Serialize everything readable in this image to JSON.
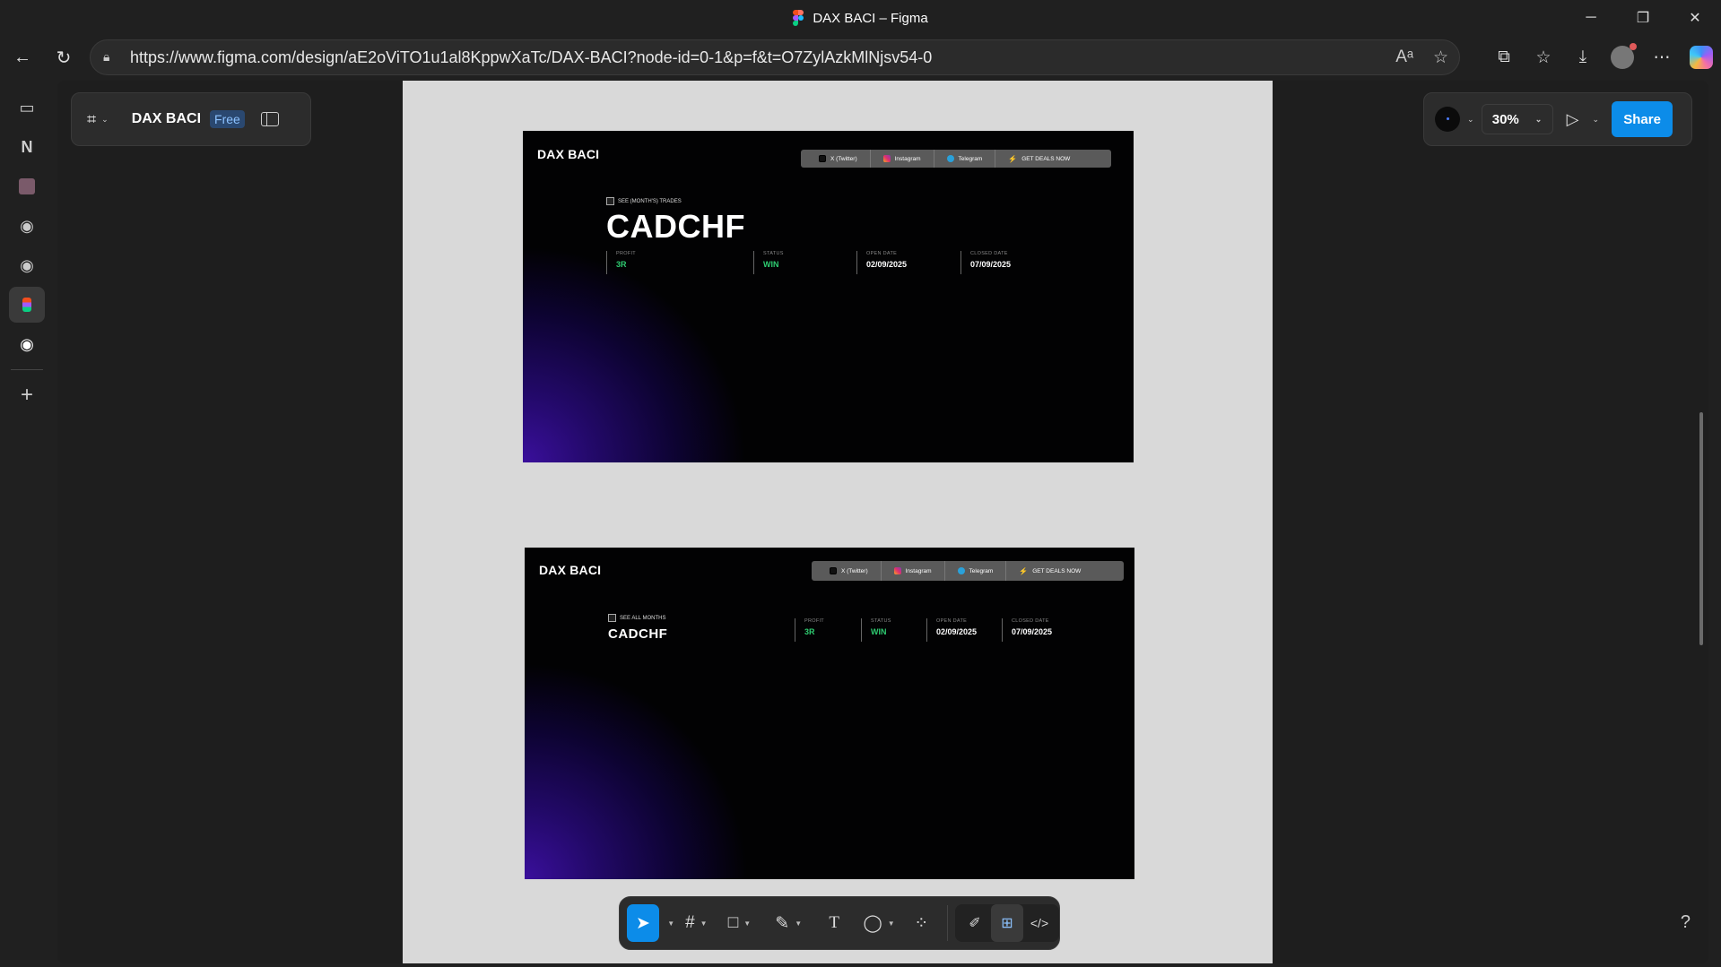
{
  "window": {
    "title": "DAX BACI – Figma"
  },
  "browser": {
    "url": "https://www.figma.com/design/aE2oViTO1u1al8KppwXaTc/DAX-BACI?node-id=0-1&p=f&t=O7ZylAzkMlNjsv54-0"
  },
  "file": {
    "name": "DAX BACI",
    "plan_badge": "Free"
  },
  "header": {
    "zoom": "30%",
    "share_label": "Share"
  },
  "frame1": {
    "brand": "DAX BACI",
    "nav": [
      "X (Twitter)",
      "Instagram",
      "Telegram",
      "GET DEALS NOW"
    ],
    "see_link": "SEE (MONTH'S) TRADES",
    "pair": "CADCHF",
    "stats": [
      {
        "label": "PROFIT",
        "value": "3R"
      },
      {
        "label": "STATUS",
        "value": "WIN"
      },
      {
        "label": "OPEN DATE",
        "value": "02/09/2025"
      },
      {
        "label": "CLOSED DATE",
        "value": "07/09/2025"
      }
    ]
  },
  "frame2": {
    "brand": "DAX BACI",
    "nav": [
      "X (Twitter)",
      "Instagram",
      "Telegram",
      "GET DEALS NOW"
    ],
    "see_link": "SEE ALL MONTHS",
    "pair": "CADCHF",
    "stats": [
      {
        "label": "PROFIT",
        "value": "3R"
      },
      {
        "label": "STATUS",
        "value": "WIN"
      },
      {
        "label": "OPEN DATE",
        "value": "02/09/2025"
      },
      {
        "label": "CLOSED DATE",
        "value": "07/09/2025"
      }
    ]
  },
  "help": "?",
  "colors": {
    "accent": "#0c8ce9",
    "win_green": "#2ecc71",
    "glow_purple": "#3a0f9c",
    "canvas": "#d9d9d9"
  }
}
